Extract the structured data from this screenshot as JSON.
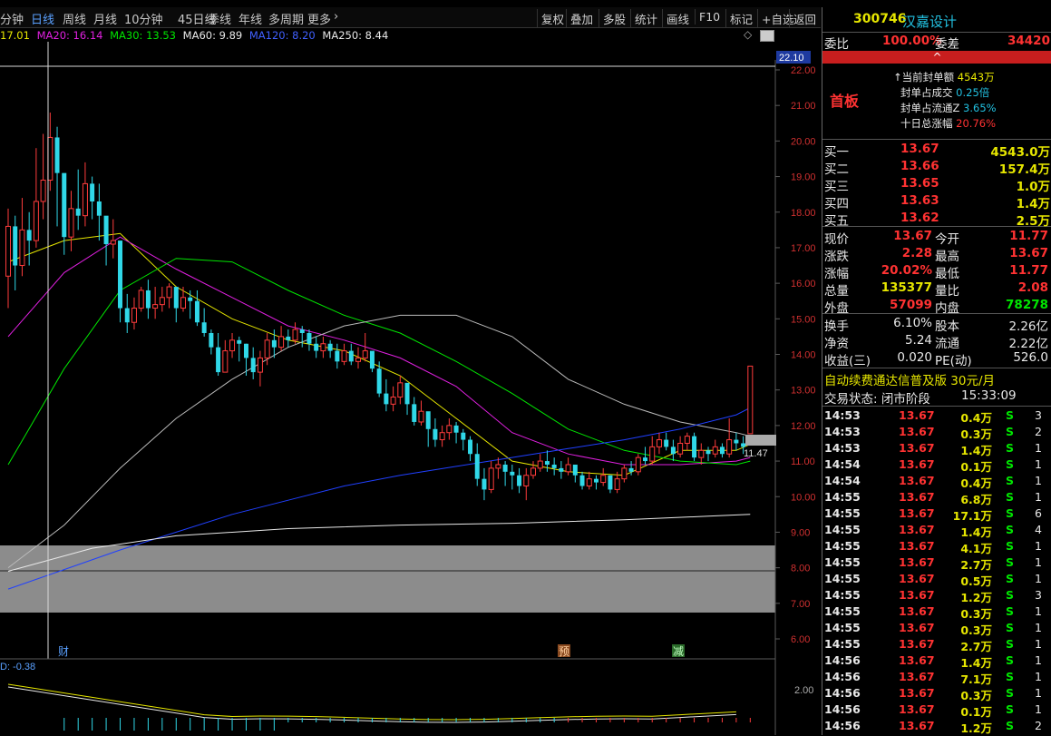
{
  "toolbar": {
    "periods": [
      "分钟",
      "日线",
      "周线",
      "月线",
      "10分钟",
      "45日线",
      "季线",
      "年线",
      "多周期",
      "更多"
    ],
    "active_period": "日线",
    "more_arrow": "›",
    "buttons": [
      "复权",
      "叠加",
      "多股",
      "统计",
      "画线",
      "F10",
      "标记",
      "+自选",
      "返回"
    ]
  },
  "ma_legend": [
    {
      "label": "17.01",
      "color": "#e6e600"
    },
    {
      "label": "MA20: 16.14",
      "color": "#e020e0"
    },
    {
      "label": "MA30: 13.53",
      "color": "#00e600"
    },
    {
      "label": "MA60: 9.89",
      "color": "#e8e8e8"
    },
    {
      "label": "MA120: 8.20",
      "color": "#2040ff"
    },
    {
      "label": "MA250: 8.44",
      "color": "#e8e8e8"
    }
  ],
  "chart_meta": {
    "price_axis_labels": [
      "22.00",
      "21.00",
      "20.00",
      "19.00",
      "18.00",
      "17.00",
      "16.00",
      "15.00",
      "14.00",
      "13.00",
      "12.00",
      "11.00",
      "10.00",
      "9.00",
      "8.00",
      "7.00",
      "6.00"
    ],
    "crosshair_price_tag": "22.10",
    "current_price_tag": "11.47",
    "event_markers": [
      "财",
      "预",
      "减"
    ],
    "indicator_label": "D: -0.38",
    "indicator_axis_label": "2.00",
    "toggle_glyph": "◇"
  },
  "chart_data": {
    "type": "candlestick",
    "ylim": [
      5.7,
      22.2
    ],
    "candles": [
      [
        16.2,
        17.6,
        18.1,
        15.3
      ],
      [
        17.6,
        16.5,
        17.9,
        15.8
      ],
      [
        16.5,
        17.5,
        18.4,
        16.2
      ],
      [
        17.5,
        17.2,
        18.0,
        16.5
      ],
      [
        17.2,
        18.3,
        19.8,
        17.0
      ],
      [
        18.3,
        18.9,
        20.2,
        17.8
      ],
      [
        18.9,
        20.1,
        20.8,
        18.6
      ],
      [
        20.1,
        19.1,
        20.4,
        17.6
      ],
      [
        19.1,
        17.3,
        18.2,
        16.8
      ],
      [
        17.3,
        18.1,
        18.6,
        16.9
      ],
      [
        18.1,
        17.9,
        19.2,
        17.5
      ],
      [
        17.9,
        18.8,
        19.4,
        17.6
      ],
      [
        18.8,
        18.3,
        19.0,
        17.8
      ],
      [
        18.3,
        17.9,
        18.8,
        17.2
      ],
      [
        17.9,
        17.1,
        17.6,
        16.5
      ],
      [
        17.1,
        17.2,
        17.8,
        16.7
      ],
      [
        17.2,
        15.3,
        16.9,
        14.9
      ],
      [
        15.3,
        14.9,
        15.7,
        14.6
      ],
      [
        14.9,
        15.3,
        15.6,
        14.7
      ],
      [
        15.3,
        15.8,
        15.9,
        15.2
      ],
      [
        15.8,
        15.3,
        16.1,
        15.0
      ],
      [
        15.3,
        15.4,
        15.9,
        15.0
      ],
      [
        15.4,
        15.6,
        15.9,
        15.2
      ],
      [
        15.6,
        15.9,
        16.0,
        15.3
      ],
      [
        15.9,
        15.3,
        15.8,
        14.9
      ],
      [
        15.3,
        15.6,
        15.9,
        15.2
      ],
      [
        15.6,
        15.5,
        15.8,
        15.0
      ],
      [
        15.5,
        14.9,
        15.8,
        14.8
      ],
      [
        14.9,
        14.6,
        15.3,
        14.5
      ],
      [
        14.6,
        14.2,
        14.7,
        14.0
      ],
      [
        14.2,
        13.5,
        14.6,
        13.4
      ],
      [
        13.5,
        14.1,
        14.4,
        13.5
      ],
      [
        14.1,
        14.4,
        14.6,
        13.9
      ],
      [
        14.4,
        14.3,
        14.5,
        13.8
      ],
      [
        14.3,
        13.9,
        14.3,
        13.4
      ],
      [
        13.9,
        13.5,
        14.2,
        13.3
      ],
      [
        13.5,
        13.9,
        14.1,
        13.1
      ],
      [
        13.9,
        14.4,
        14.6,
        13.7
      ],
      [
        14.4,
        14.2,
        14.7,
        13.9
      ],
      [
        14.2,
        14.5,
        14.8,
        14.1
      ],
      [
        14.5,
        14.4,
        14.7,
        14.2
      ],
      [
        14.4,
        14.7,
        14.9,
        14.3
      ],
      [
        14.7,
        14.6,
        14.8,
        14.2
      ],
      [
        14.6,
        14.3,
        14.7,
        14.1
      ],
      [
        14.3,
        14.1,
        14.5,
        13.9
      ],
      [
        14.1,
        14.3,
        14.5,
        13.9
      ],
      [
        14.3,
        14.1,
        14.4,
        13.9
      ],
      [
        14.1,
        13.8,
        14.3,
        13.6
      ],
      [
        13.8,
        14.1,
        14.3,
        13.7
      ],
      [
        14.1,
        13.8,
        14.3,
        13.7
      ],
      [
        13.8,
        13.9,
        14.2,
        13.6
      ],
      [
        13.9,
        14.1,
        14.6,
        13.8
      ],
      [
        14.1,
        13.6,
        13.9,
        13.5
      ],
      [
        13.6,
        12.9,
        13.8,
        12.8
      ],
      [
        12.9,
        12.6,
        13.3,
        12.4
      ],
      [
        12.6,
        12.8,
        13.1,
        12.4
      ],
      [
        12.8,
        13.2,
        13.4,
        12.6
      ],
      [
        13.2,
        12.6,
        13.1,
        12.3
      ],
      [
        12.6,
        12.1,
        12.8,
        12.0
      ],
      [
        12.1,
        12.4,
        12.7,
        12.0
      ],
      [
        12.4,
        11.9,
        12.3,
        11.4
      ],
      [
        11.9,
        11.6,
        12.2,
        11.4
      ],
      [
        11.6,
        11.8,
        12.0,
        11.4
      ],
      [
        11.8,
        12.0,
        12.2,
        11.6
      ],
      [
        12.0,
        11.8,
        12.1,
        11.5
      ],
      [
        11.8,
        11.6,
        11.9,
        11.3
      ],
      [
        11.6,
        11.2,
        11.7,
        11.0
      ],
      [
        11.2,
        10.5,
        11.5,
        10.3
      ],
      [
        10.5,
        10.2,
        10.8,
        9.9
      ],
      [
        10.2,
        10.8,
        11.0,
        10.1
      ],
      [
        10.8,
        10.9,
        11.1,
        10.5
      ],
      [
        10.9,
        10.7,
        11.0,
        10.3
      ],
      [
        10.7,
        10.6,
        10.9,
        10.2
      ],
      [
        10.6,
        10.3,
        10.8,
        10.1
      ],
      [
        10.3,
        10.6,
        10.8,
        9.9
      ],
      [
        10.6,
        10.8,
        11.0,
        10.5
      ],
      [
        10.8,
        11.0,
        11.2,
        10.7
      ],
      [
        11.0,
        10.9,
        11.3,
        10.7
      ],
      [
        10.9,
        10.8,
        11.1,
        10.6
      ],
      [
        10.8,
        10.7,
        11.0,
        10.5
      ],
      [
        10.7,
        10.9,
        11.1,
        10.6
      ],
      [
        10.9,
        10.6,
        10.9,
        10.4
      ],
      [
        10.6,
        10.3,
        10.7,
        10.2
      ],
      [
        10.3,
        10.5,
        10.7,
        10.2
      ],
      [
        10.5,
        10.4,
        10.6,
        10.2
      ],
      [
        10.4,
        10.6,
        10.8,
        10.3
      ],
      [
        10.6,
        10.2,
        10.6,
        10.1
      ],
      [
        10.2,
        10.5,
        10.7,
        10.1
      ],
      [
        10.5,
        10.8,
        10.9,
        10.4
      ],
      [
        10.8,
        10.7,
        11.0,
        10.6
      ],
      [
        10.7,
        11.1,
        11.2,
        10.6
      ],
      [
        11.1,
        11.0,
        11.4,
        10.9
      ],
      [
        11.0,
        11.4,
        11.7,
        10.9
      ],
      [
        11.4,
        11.6,
        11.8,
        11.2
      ],
      [
        11.6,
        11.4,
        11.8,
        11.3
      ],
      [
        11.4,
        11.2,
        11.6,
        11.0
      ],
      [
        11.2,
        11.5,
        11.7,
        11.1
      ],
      [
        11.5,
        11.7,
        11.8,
        11.3
      ],
      [
        11.7,
        11.1,
        11.8,
        11.0
      ],
      [
        11.1,
        11.3,
        11.5,
        10.9
      ],
      [
        11.3,
        11.2,
        11.4,
        11.0
      ],
      [
        11.2,
        11.4,
        11.6,
        11.1
      ],
      [
        11.4,
        11.2,
        11.5,
        11.1
      ],
      [
        11.2,
        11.6,
        12.2,
        11.1
      ],
      [
        11.6,
        11.5,
        11.8,
        11.3
      ],
      [
        11.5,
        11.4,
        11.7,
        11.2
      ],
      [
        11.77,
        13.67,
        13.67,
        11.77
      ]
    ],
    "ma_lines": {
      "ma_a": {
        "color": "#e6e600",
        "points": [
          [
            0,
            16.6
          ],
          [
            8,
            17.2
          ],
          [
            16,
            17.4
          ],
          [
            24,
            15.9
          ],
          [
            32,
            15.0
          ],
          [
            40,
            14.4
          ],
          [
            48,
            14.1
          ],
          [
            56,
            13.4
          ],
          [
            64,
            12.2
          ],
          [
            72,
            11.0
          ],
          [
            80,
            10.7
          ],
          [
            88,
            10.6
          ],
          [
            96,
            11.3
          ],
          [
            104,
            11.3
          ],
          [
            106,
            11.47
          ]
        ]
      },
      "ma20": {
        "color": "#e020e0",
        "points": [
          [
            0,
            14.5
          ],
          [
            8,
            16.3
          ],
          [
            16,
            17.3
          ],
          [
            24,
            16.4
          ],
          [
            32,
            15.6
          ],
          [
            40,
            14.8
          ],
          [
            48,
            14.4
          ],
          [
            56,
            13.9
          ],
          [
            64,
            13.1
          ],
          [
            72,
            11.8
          ],
          [
            80,
            11.2
          ],
          [
            88,
            10.9
          ],
          [
            96,
            10.9
          ],
          [
            104,
            11.0
          ],
          [
            106,
            11.1
          ]
        ]
      },
      "ma30": {
        "color": "#00e600",
        "points": [
          [
            0,
            10.9
          ],
          [
            8,
            13.6
          ],
          [
            16,
            15.8
          ],
          [
            24,
            16.7
          ],
          [
            32,
            16.6
          ],
          [
            40,
            15.8
          ],
          [
            48,
            15.1
          ],
          [
            56,
            14.6
          ],
          [
            64,
            13.8
          ],
          [
            72,
            12.9
          ],
          [
            80,
            11.9
          ],
          [
            88,
            11.3
          ],
          [
            96,
            11.0
          ],
          [
            104,
            10.9
          ],
          [
            106,
            11.0
          ]
        ]
      },
      "ma60": {
        "color": "#bbbbbb",
        "points": [
          [
            0,
            8.0
          ],
          [
            8,
            9.2
          ],
          [
            16,
            10.8
          ],
          [
            24,
            12.2
          ],
          [
            32,
            13.3
          ],
          [
            40,
            14.2
          ],
          [
            48,
            14.8
          ],
          [
            56,
            15.1
          ],
          [
            64,
            15.1
          ],
          [
            72,
            14.5
          ],
          [
            80,
            13.3
          ],
          [
            88,
            12.6
          ],
          [
            96,
            12.1
          ],
          [
            104,
            11.8
          ],
          [
            106,
            11.7
          ]
        ]
      },
      "ma120": {
        "color": "#2040ff",
        "points": [
          [
            0,
            7.4
          ],
          [
            8,
            7.95
          ],
          [
            16,
            8.5
          ],
          [
            24,
            9.0
          ],
          [
            32,
            9.5
          ],
          [
            40,
            9.9
          ],
          [
            48,
            10.3
          ],
          [
            56,
            10.6
          ],
          [
            64,
            10.85
          ],
          [
            72,
            11.1
          ],
          [
            80,
            11.35
          ],
          [
            88,
            11.6
          ],
          [
            96,
            11.9
          ],
          [
            104,
            12.3
          ],
          [
            106,
            12.5
          ]
        ]
      },
      "ma250": {
        "color": "#e8e8e8",
        "points": [
          [
            0,
            7.9
          ],
          [
            12,
            8.55
          ],
          [
            24,
            8.9
          ],
          [
            40,
            9.1
          ],
          [
            56,
            9.2
          ],
          [
            72,
            9.25
          ],
          [
            88,
            9.35
          ],
          [
            100,
            9.45
          ],
          [
            106,
            9.5
          ]
        ]
      }
    }
  },
  "panel": {
    "code": "300746",
    "name": "汉嘉设计",
    "weibi_label": "委比",
    "weibi_value": "100.00%",
    "weicha_label": "委差",
    "weicha_value": "34420",
    "collapse_glyph": "^",
    "shouban_label": "首板",
    "seal_rows": [
      {
        "label": "↑当前封单额",
        "value": "4543万"
      },
      {
        "label": "封单占成交",
        "value": "0.25倍"
      },
      {
        "label": "封单占流通Z",
        "value": "3.65%"
      },
      {
        "label": "十日总涨幅",
        "value": "20.76%"
      }
    ],
    "bids": [
      {
        "label": "买一",
        "price": "13.67",
        "vol": "4543.0万"
      },
      {
        "label": "买二",
        "price": "13.66",
        "vol": "157.4万"
      },
      {
        "label": "买三",
        "price": "13.65",
        "vol": "1.0万"
      },
      {
        "label": "买四",
        "price": "13.63",
        "vol": "1.4万"
      },
      {
        "label": "买五",
        "price": "13.62",
        "vol": "2.5万"
      }
    ],
    "quote": [
      {
        "l1": "现价",
        "v1": "13.67",
        "c1": "red",
        "l2": "今开",
        "v2": "11.77",
        "c2": "red"
      },
      {
        "l1": "涨跌",
        "v1": "2.28",
        "c1": "red",
        "l2": "最高",
        "v2": "13.67",
        "c2": "red"
      },
      {
        "l1": "涨幅",
        "v1": "20.02%",
        "c1": "red",
        "l2": "最低",
        "v2": "11.77",
        "c2": "red"
      },
      {
        "l1": "总量",
        "v1": "135377",
        "c1": "yel",
        "l2": "量比",
        "v2": "2.08",
        "c2": "red"
      },
      {
        "l1": "外盘",
        "v1": "57099",
        "c1": "red",
        "l2": "内盘",
        "v2": "78278",
        "c2": "grn"
      }
    ],
    "fund": [
      {
        "l1": "换手",
        "v1": "6.10%",
        "l2": "股本",
        "v2": "2.26亿"
      },
      {
        "l1": "净资",
        "v1": "5.24",
        "l2": "流通",
        "v2": "2.22亿"
      },
      {
        "l1": "收益(三)",
        "v1": "0.020",
        "l2": "PE(动)",
        "v2": "526.0"
      }
    ],
    "promo": "自动续费通达信普及版 30元/月",
    "status_label": "交易状态: 闭市阶段",
    "status_time": "15:33:09",
    "trades": [
      {
        "t": "14:53",
        "p": "13.67",
        "v": "0.4万",
        "s": "S",
        "n": "3"
      },
      {
        "t": "14:53",
        "p": "13.67",
        "v": "0.3万",
        "s": "S",
        "n": "2"
      },
      {
        "t": "14:53",
        "p": "13.67",
        "v": "1.4万",
        "s": "S",
        "n": "1"
      },
      {
        "t": "14:54",
        "p": "13.67",
        "v": "0.1万",
        "s": "S",
        "n": "1"
      },
      {
        "t": "14:54",
        "p": "13.67",
        "v": "0.4万",
        "s": "S",
        "n": "1"
      },
      {
        "t": "14:55",
        "p": "13.67",
        "v": "6.8万",
        "s": "S",
        "n": "1"
      },
      {
        "t": "14:55",
        "p": "13.67",
        "v": "17.1万",
        "s": "S",
        "n": "6"
      },
      {
        "t": "14:55",
        "p": "13.67",
        "v": "1.4万",
        "s": "S",
        "n": "4"
      },
      {
        "t": "14:55",
        "p": "13.67",
        "v": "4.1万",
        "s": "S",
        "n": "1"
      },
      {
        "t": "14:55",
        "p": "13.67",
        "v": "2.7万",
        "s": "S",
        "n": "1"
      },
      {
        "t": "14:55",
        "p": "13.67",
        "v": "0.5万",
        "s": "S",
        "n": "1"
      },
      {
        "t": "14:55",
        "p": "13.67",
        "v": "1.2万",
        "s": "S",
        "n": "3"
      },
      {
        "t": "14:55",
        "p": "13.67",
        "v": "0.3万",
        "s": "S",
        "n": "1"
      },
      {
        "t": "14:55",
        "p": "13.67",
        "v": "0.3万",
        "s": "S",
        "n": "1"
      },
      {
        "t": "14:55",
        "p": "13.67",
        "v": "2.7万",
        "s": "S",
        "n": "1"
      },
      {
        "t": "14:56",
        "p": "13.67",
        "v": "1.4万",
        "s": "S",
        "n": "1"
      },
      {
        "t": "14:56",
        "p": "13.67",
        "v": "7.1万",
        "s": "S",
        "n": "1"
      },
      {
        "t": "14:56",
        "p": "13.67",
        "v": "0.3万",
        "s": "S",
        "n": "1"
      },
      {
        "t": "14:56",
        "p": "13.67",
        "v": "0.1万",
        "s": "S",
        "n": "1"
      },
      {
        "t": "14:56",
        "p": "13.67",
        "v": "1.2万",
        "s": "S",
        "n": "2"
      }
    ]
  }
}
